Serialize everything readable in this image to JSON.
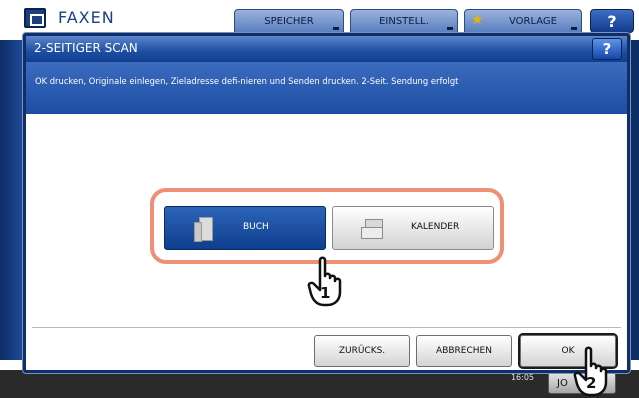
{
  "background_app": {
    "title": "FAXEN",
    "tabs": [
      {
        "label": "SPEICHER"
      },
      {
        "label": "EINSTELL."
      },
      {
        "label": "VORLAGE"
      }
    ],
    "help_label": "?",
    "footer": {
      "time": "16:05",
      "jobs_label": "JO"
    }
  },
  "dialog": {
    "title": "2-SEITIGER SCAN",
    "help_label": "?",
    "message": "OK drucken, Originale einlegen, Zieladresse defi-nieren und Senden drucken. 2-Seit. Sendung erfolgt",
    "options": [
      {
        "label": "BUCH",
        "icon": "book-icon",
        "selected": true
      },
      {
        "label": "KALENDER",
        "icon": "calendar-icon",
        "selected": false
      }
    ],
    "buttons": {
      "back": "ZURÜCKS.",
      "cancel": "ABBRECHEN",
      "ok": "OK"
    }
  },
  "annotations": {
    "step_1": "1",
    "step_2": "2"
  },
  "colors": {
    "accent_blue": "#1d4ea3",
    "highlight_ring": "#ee8f76"
  }
}
